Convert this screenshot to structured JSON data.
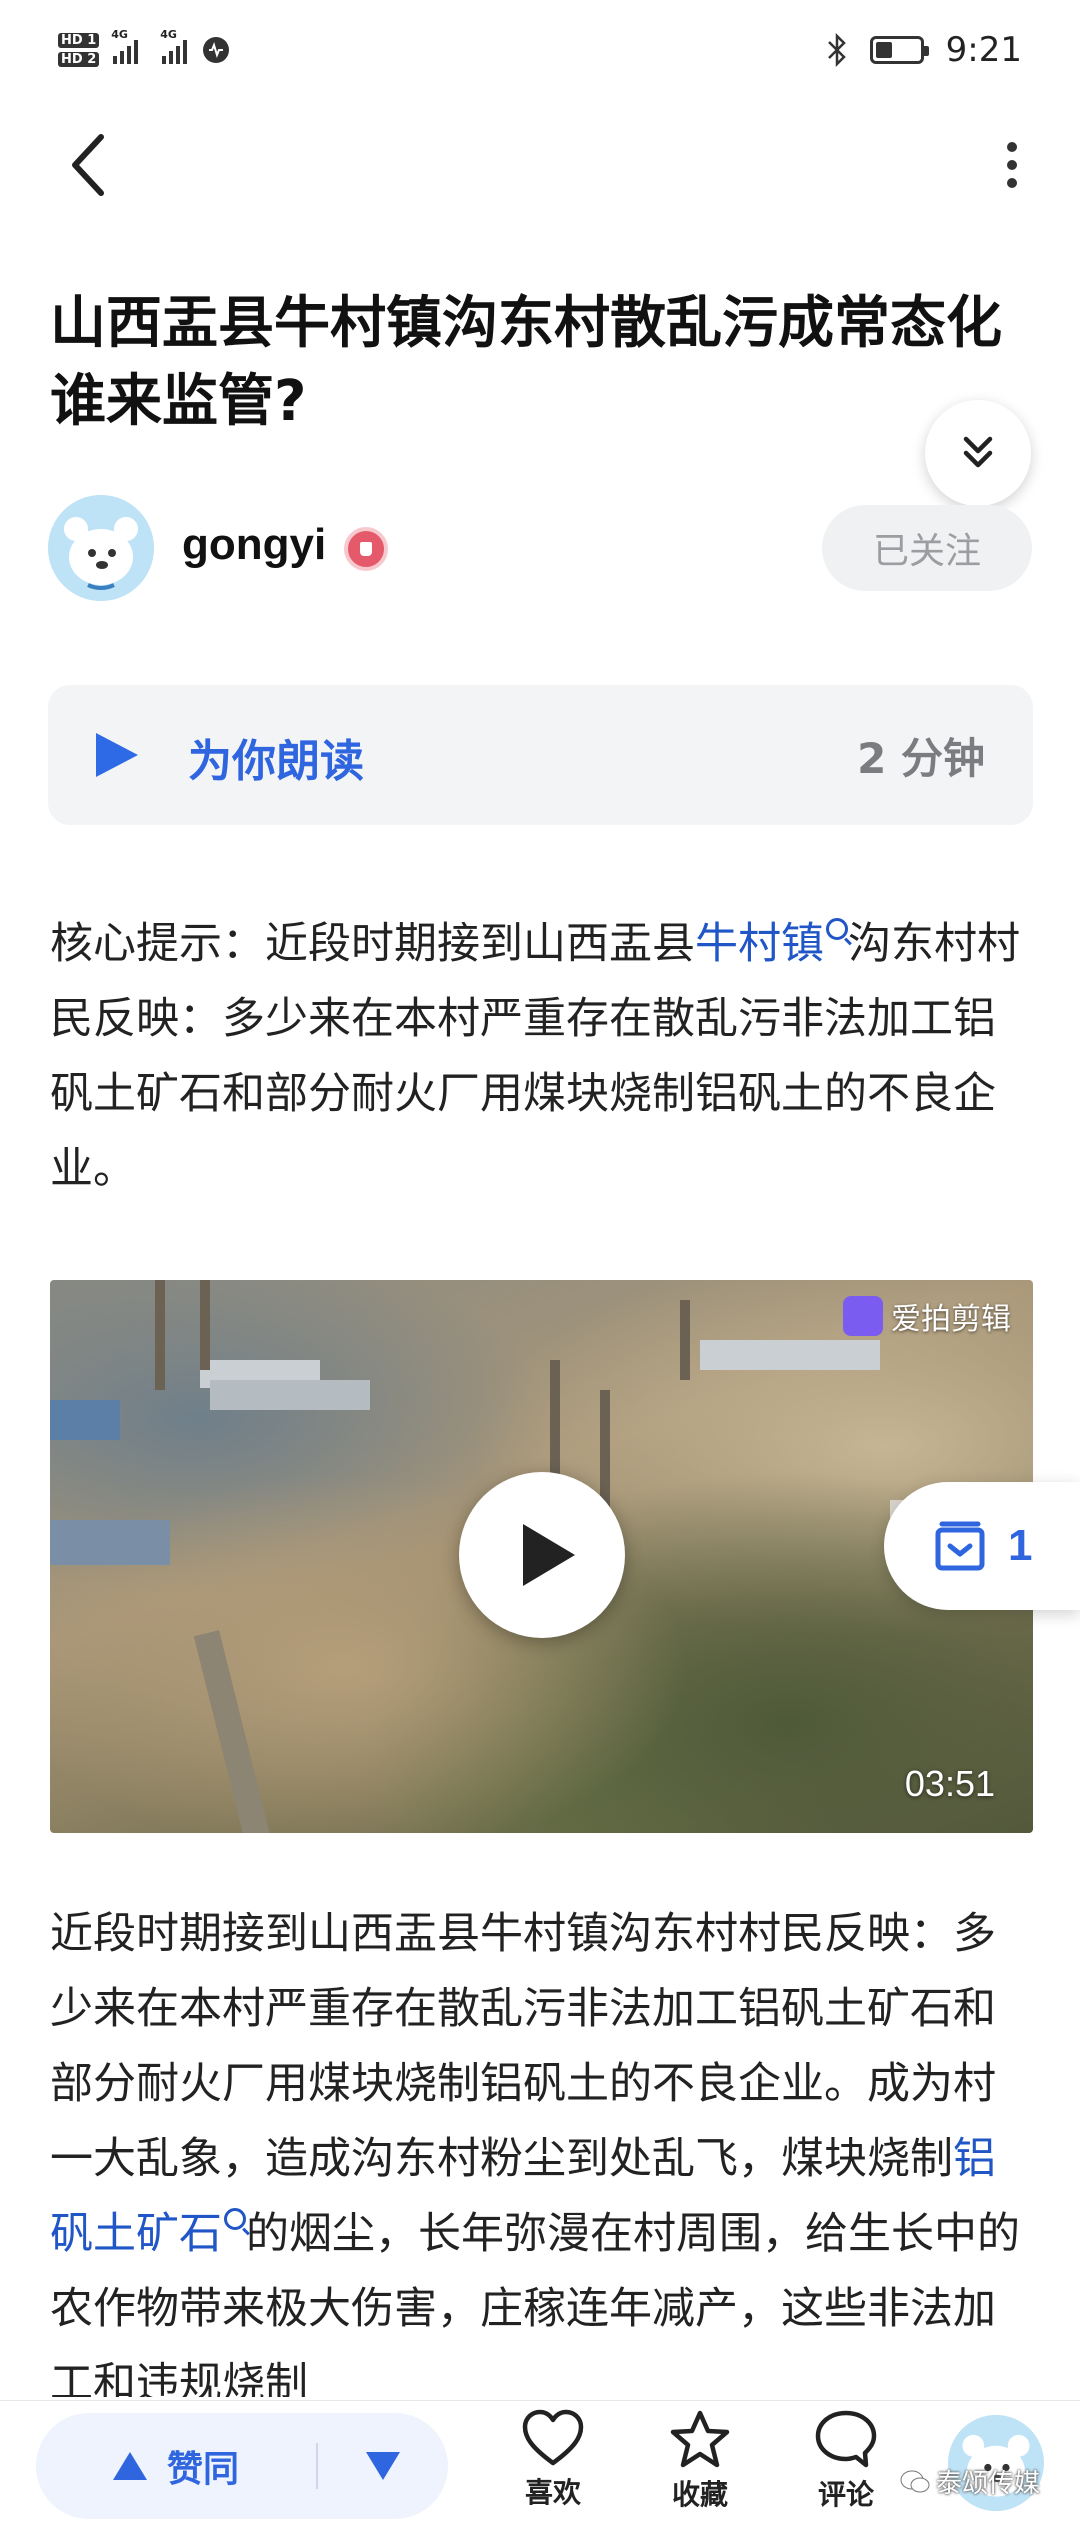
{
  "status_bar": {
    "sim1": "HD 1",
    "sim2": "HD 2",
    "net1": "4G",
    "net2": "4G",
    "time": "9:21",
    "battery_level": 0.35
  },
  "nav": {
    "back_icon": "chevron-left-icon",
    "more_icon": "more-vertical-icon"
  },
  "article": {
    "title": "山西盂县牛村镇沟东村散乱污成常态化谁来监管?",
    "author": {
      "name": "gongyi",
      "follow_label": "已关注"
    },
    "read_aloud": {
      "label": "为你朗读",
      "duration": "2 分钟"
    },
    "para1": {
      "before": "核心提示：近段时期接到山西盂县",
      "link": "牛村镇",
      "after": "沟东村村民反映：多少来在本村严重存在散乱污非法加工铝矾土矿石和部分耐火厂用煤块烧制铝矾土的不良企业。"
    },
    "video": {
      "watermark": "爱拍剪辑",
      "duration": "03:51"
    },
    "para2": {
      "before": "近段时期接到山西盂县牛村镇沟东村村民反映：多少来在本村严重存在散乱污非法加工铝矾土矿石和部分耐火厂用煤块烧制铝矾土的不良企业。成为村一大乱象，造成沟东村粉尘到处乱飞，煤块烧制",
      "link": "铝矾土矿石",
      "after": "的烟尘，长年弥漫在村周围，给生长中的农作物带来极大伤害，庄稼连年减产，这些非法加工和违规烧制"
    }
  },
  "float_action": {
    "count": "1"
  },
  "bottom_bar": {
    "upvote_label": "赞同",
    "like_label": "喜欢",
    "favorite_label": "收藏",
    "comment_label": "评论",
    "watermark": "泰颂传媒"
  },
  "colors": {
    "accent": "#2f66e0",
    "link": "#2156c7",
    "card_bg": "#f3f4f6"
  }
}
